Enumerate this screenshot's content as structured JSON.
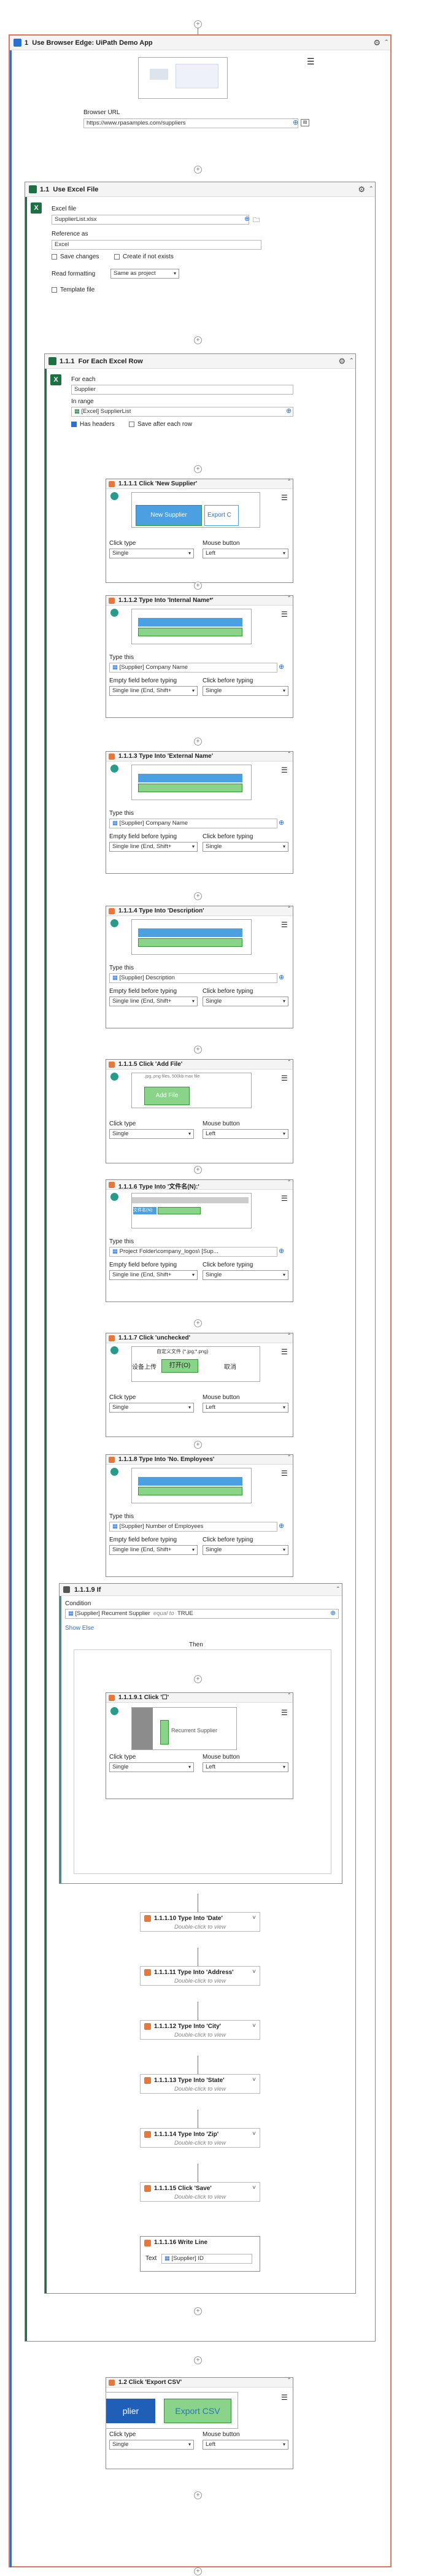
{
  "main": {
    "number": "1",
    "title": "Use Browser Edge: UiPath Demo App",
    "browser_url_label": "Browser URL",
    "browser_url": "https://www.rpasamples.com/suppliers"
  },
  "excel": {
    "number": "1.1",
    "title": "Use Excel File",
    "file_label": "Excel file",
    "file_value": "SupplierList.xlsx",
    "reference_label": "Reference as",
    "reference_value": "Excel",
    "save_changes": "Save changes",
    "create_if_not_exists": "Create if not exists",
    "read_formatting_label": "Read formatting",
    "read_formatting_value": "Same as project",
    "template_file": "Template file"
  },
  "foreach": {
    "number": "1.1.1",
    "title": "For Each Excel Row",
    "for_each_label": "For each",
    "for_each_value": "Supplier",
    "in_range_label": "In range",
    "in_range_value": "[Excel] SupplierList",
    "has_headers": "Has headers",
    "save_after_each_row": "Save after each row"
  },
  "labels": {
    "click_type": "Click type",
    "mouse_button": "Mouse button",
    "type_this": "Type this",
    "empty_field": "Empty field before typing",
    "click_before": "Click before typing",
    "single": "Single",
    "left": "Left",
    "single_line": "Single line (End, Shift+",
    "double_click": "Double-click to view"
  },
  "acts": {
    "a1": {
      "title": "1.1.1.1  Click 'New Supplier'",
      "thumb1": "New Supplier",
      "thumb2": "Export C"
    },
    "a2": {
      "title": "1.1.1.2  Type Into 'Internal Name*'",
      "value": "[Supplier] Company Name"
    },
    "a3": {
      "title": "1.1.1.3  Type Into 'External Name'",
      "value": "[Supplier] Company Name"
    },
    "a4": {
      "title": "1.1.1.4  Type Into 'Description'",
      "value": "[Supplier] Description"
    },
    "a5": {
      "title": "1.1.1.5  Click 'Add File'",
      "thumb": "Add File",
      "hint": ".jpg,.png files, 500kb max file"
    },
    "a6": {
      "title": "1.1.1.6  Type Into '文件名(N):'",
      "value": "Project Folder\\company_logos\\ [Sup...",
      "thumb": "文件名(N):"
    },
    "a7": {
      "title": "1.1.1.7  Click 'unchecked'",
      "t1": "设备上传",
      "t2": "打开(O)",
      "t3": "取消",
      "t4": "自定义文件 (*.jpg;*.png)"
    },
    "a8": {
      "title": "1.1.1.8  Type Into 'No. Employees'",
      "value": "[Supplier] Number of Employees"
    }
  },
  "ifblock": {
    "title": "1.1.1.9  If",
    "condition_label": "Condition",
    "condition_value": "[Supplier] Recurrent Supplier",
    "operator": "equal to",
    "rhs": "TRUE",
    "show_else": "Show Else",
    "then": "Then",
    "inner": {
      "title": "1.1.1.9.1  Click '☐'",
      "thumb": "Recurrent Supplier"
    }
  },
  "minis": [
    {
      "title": "1.1.1.10  Type Into 'Date'"
    },
    {
      "title": "1.1.1.11  Type Into 'Address'"
    },
    {
      "title": "1.1.1.12  Type Into 'City'"
    },
    {
      "title": "1.1.1.13  Type Into 'State'"
    },
    {
      "title": "1.1.1.14  Type Into 'Zip'"
    },
    {
      "title": "1.1.1.15  Click 'Save'"
    }
  ],
  "writeline": {
    "title": "1.1.1.16  Write Line",
    "text_label": "Text",
    "value": "[Supplier] ID"
  },
  "export": {
    "title": "1.2  Click 'Export CSV'",
    "t1": "plier",
    "t2": "Export CSV"
  },
  "colors": {
    "selection": "#e0755e",
    "excel": "#1d7044",
    "accent": "#2a71d0",
    "target": "#8ad48a"
  }
}
